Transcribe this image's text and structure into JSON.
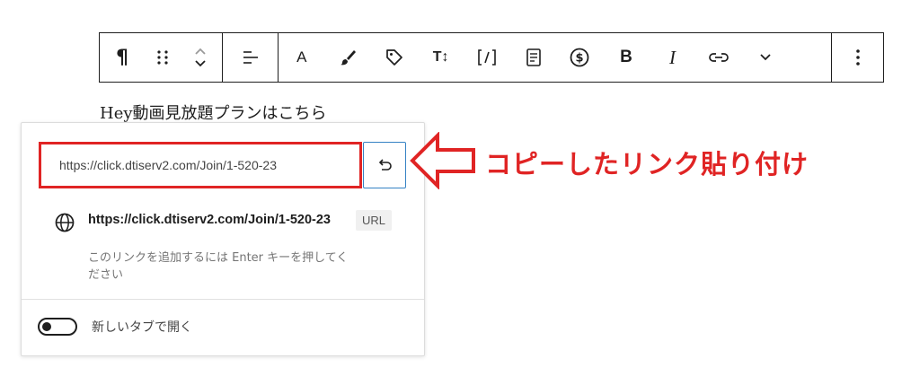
{
  "toolbar": {
    "paragraph_symbol": "¶",
    "buttons": {
      "text_color_letter": "A",
      "bold": "B",
      "italic": "I",
      "font_size": "T↕"
    }
  },
  "block": {
    "heading_text": "Hey動画見放題プランはこちら"
  },
  "link_popover": {
    "input_value": "https://click.dtiserv2.com/Join/1-520-23",
    "suggestion_url": "https://click.dtiserv2.com/Join/1-520-23",
    "suggestion_hint": "このリンクを追加するには Enter キーを押してください",
    "suggestion_type_badge": "URL",
    "open_in_new_tab_label": "新しいタブで開く",
    "open_in_new_tab_checked": false
  },
  "annotation": {
    "text": "コピーしたリンク貼り付け",
    "color": "#e02424"
  },
  "colors": {
    "highlight_red": "#e02424",
    "focus_blue": "#3582c4"
  }
}
